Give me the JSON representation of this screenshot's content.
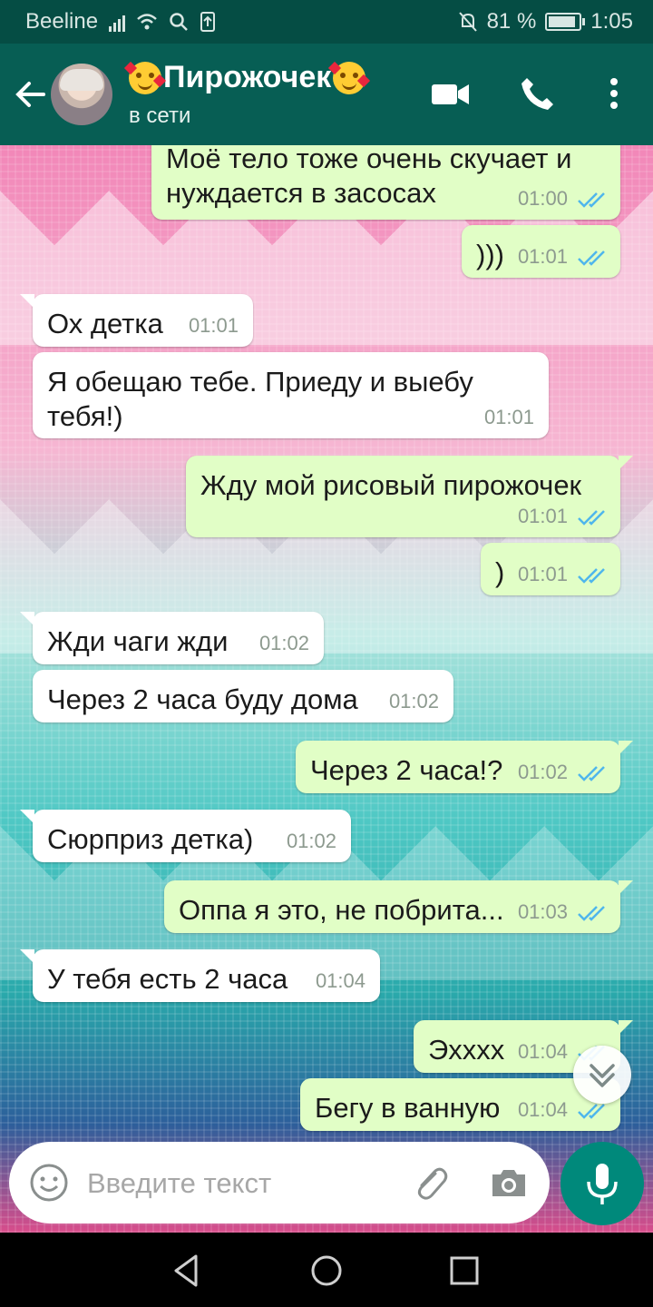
{
  "status_bar": {
    "carrier": "Beeline",
    "battery_percent": "81 %",
    "clock": "1:05"
  },
  "header": {
    "contact_name": "Пирожочек",
    "presence": "в сети"
  },
  "messages": [
    {
      "dir": "out",
      "text": "Моё тело тоже очень скучает и нуждается в засосах",
      "time": "01:00"
    },
    {
      "dir": "out",
      "text": ")))",
      "time": "01:01"
    },
    {
      "dir": "in",
      "text": "Ох детка",
      "time": "01:01"
    },
    {
      "dir": "in",
      "text": "Я обещаю тебе. Приеду и выебу тебя!)",
      "time": "01:01"
    },
    {
      "dir": "out",
      "text": "Жду мой рисовый пирожочек",
      "time": "01:01"
    },
    {
      "dir": "out",
      "text": ")",
      "time": "01:01"
    },
    {
      "dir": "in",
      "text": "Жди чаги жди",
      "time": "01:02"
    },
    {
      "dir": "in",
      "text": "Через 2 часа буду дома",
      "time": "01:02"
    },
    {
      "dir": "out",
      "text": "Через 2 часа!?",
      "time": "01:02"
    },
    {
      "dir": "in",
      "text": "Сюрприз детка)",
      "time": "01:02"
    },
    {
      "dir": "out",
      "text": "Оппа я это, не побрита...",
      "time": "01:03"
    },
    {
      "dir": "in",
      "text": "У тебя есть 2 часа",
      "time": "01:04"
    },
    {
      "dir": "out",
      "text": "Эхххх",
      "time": "01:04"
    },
    {
      "dir": "out",
      "text": "Бегу в ванную",
      "time": "01:04"
    }
  ],
  "composer": {
    "placeholder": "Введите текст"
  },
  "icons": {
    "back": "arrow-left-icon",
    "video_call": "video-camera-icon",
    "voice_call": "phone-icon",
    "menu": "more-vertical-icon",
    "emoji": "smiley-icon",
    "attach": "paperclip-icon",
    "camera": "camera-icon",
    "mic": "microphone-icon",
    "scroll_down": "double-chevron-down-icon"
  },
  "colors": {
    "header": "#075e54",
    "status_bar": "#054d44",
    "outgoing_bubble": "#e1fec6",
    "incoming_bubble": "#ffffff",
    "read_ticks": "#4fb6ec",
    "mic_button": "#00897b"
  }
}
